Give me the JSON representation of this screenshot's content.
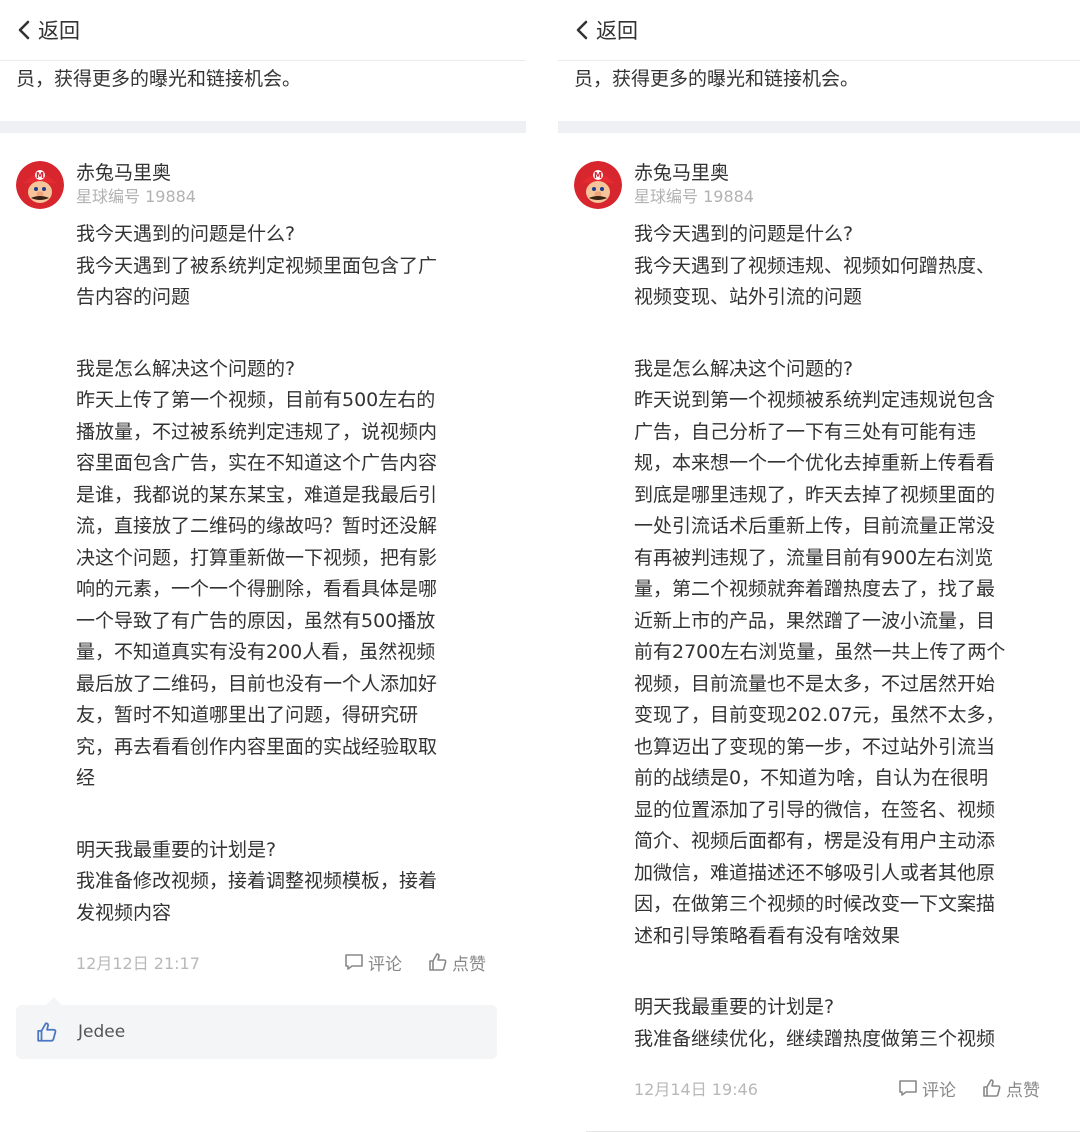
{
  "left": {
    "back_label": "返回",
    "intro": "员，获得更多的曝光和链接机会。",
    "author": {
      "name": "赤兔马里奥",
      "member_id": "星球编号 19884"
    },
    "paragraphs": [
      "我今天遇到的问题是什么?",
      "我今天遇到了被系统判定视频里面包含了广\n告内容的问题",
      "我是怎么解决这个问题的?",
      "昨天上传了第一个视频，目前有500左右的\n播放量，不过被系统判定违规了，说视频内\n容里面包含广告，实在不知道这个广告内容\n是谁，我都说的某东某宝，难道是我最后引\n流，直接放了二维码的缘故吗？暂时还没解\n决这个问题，打算重新做一下视频，把有影\n响的元素，一个一个得删除，看看具体是哪\n一个导致了有广告的原因，虽然有500播放\n量，不知道真实有没有200人看，虽然视频\n最后放了二维码，目前也没有一个人添加好\n友，暂时不知道哪里出了问题，得研究研\n究，再去看看创作内容里面的实战经验取取\n经",
      "明天我最重要的计划是?",
      "我准备修改视频，接着调整视频模板，接着\n发视频内容"
    ],
    "date": "12月12日 21:17",
    "comment_label": "评论",
    "like_label": "点赞",
    "liker": "Jedee"
  },
  "right": {
    "back_label": "返回",
    "intro": "员，获得更多的曝光和链接机会。",
    "author": {
      "name": "赤兔马里奥",
      "member_id": "星球编号 19884"
    },
    "paragraphs": [
      "我今天遇到的问题是什么?",
      "我今天遇到了视频违规、视频如何蹭热度、\n视频变现、站外引流的问题",
      "我是怎么解决这个问题的?",
      "昨天说到第一个视频被系统判定违规说包含\n广告，自己分析了一下有三处有可能有违\n规，本来想一个一个优化去掉重新上传看看\n到底是哪里违规了，昨天去掉了视频里面的\n一处引流话术后重新上传，目前流量正常没\n有再被判违规了，流量目前有900左右浏览\n量，第二个视频就奔着蹭热度去了，找了最\n近新上市的产品，果然蹭了一波小流量，目\n前有2700左右浏览量，虽然一共上传了两个\n视频，目前流量也不是太多，不过居然开始\n变现了，目前变现202.07元，虽然不太多，\n也算迈出了变现的第一步，不过站外引流当\n前的战绩是0，不知道为啥，自认为在很明\n显的位置添加了引导的微信，在签名、视频\n简介、视频后面都有，楞是没有用户主动添\n加微信，难道描述还不够吸引人或者其他原\n因，在做第三个视频的时候改变一下文案描\n述和引导策略看看有没有啥效果",
      "明天我最重要的计划是?",
      "我准备继续优化，继续蹭热度做第三个视频"
    ],
    "date": "12月14日 19:46",
    "comment_label": "评论",
    "like_label": "点赞"
  },
  "colors": {
    "text": "#333333",
    "muted": "#b2b2b2",
    "divider": "#eef0f3",
    "likes_bg": "#f4f5f7"
  },
  "icons": [
    "chevron-left-icon",
    "avatar-mario",
    "comment-icon",
    "thumbs-up-icon"
  ]
}
